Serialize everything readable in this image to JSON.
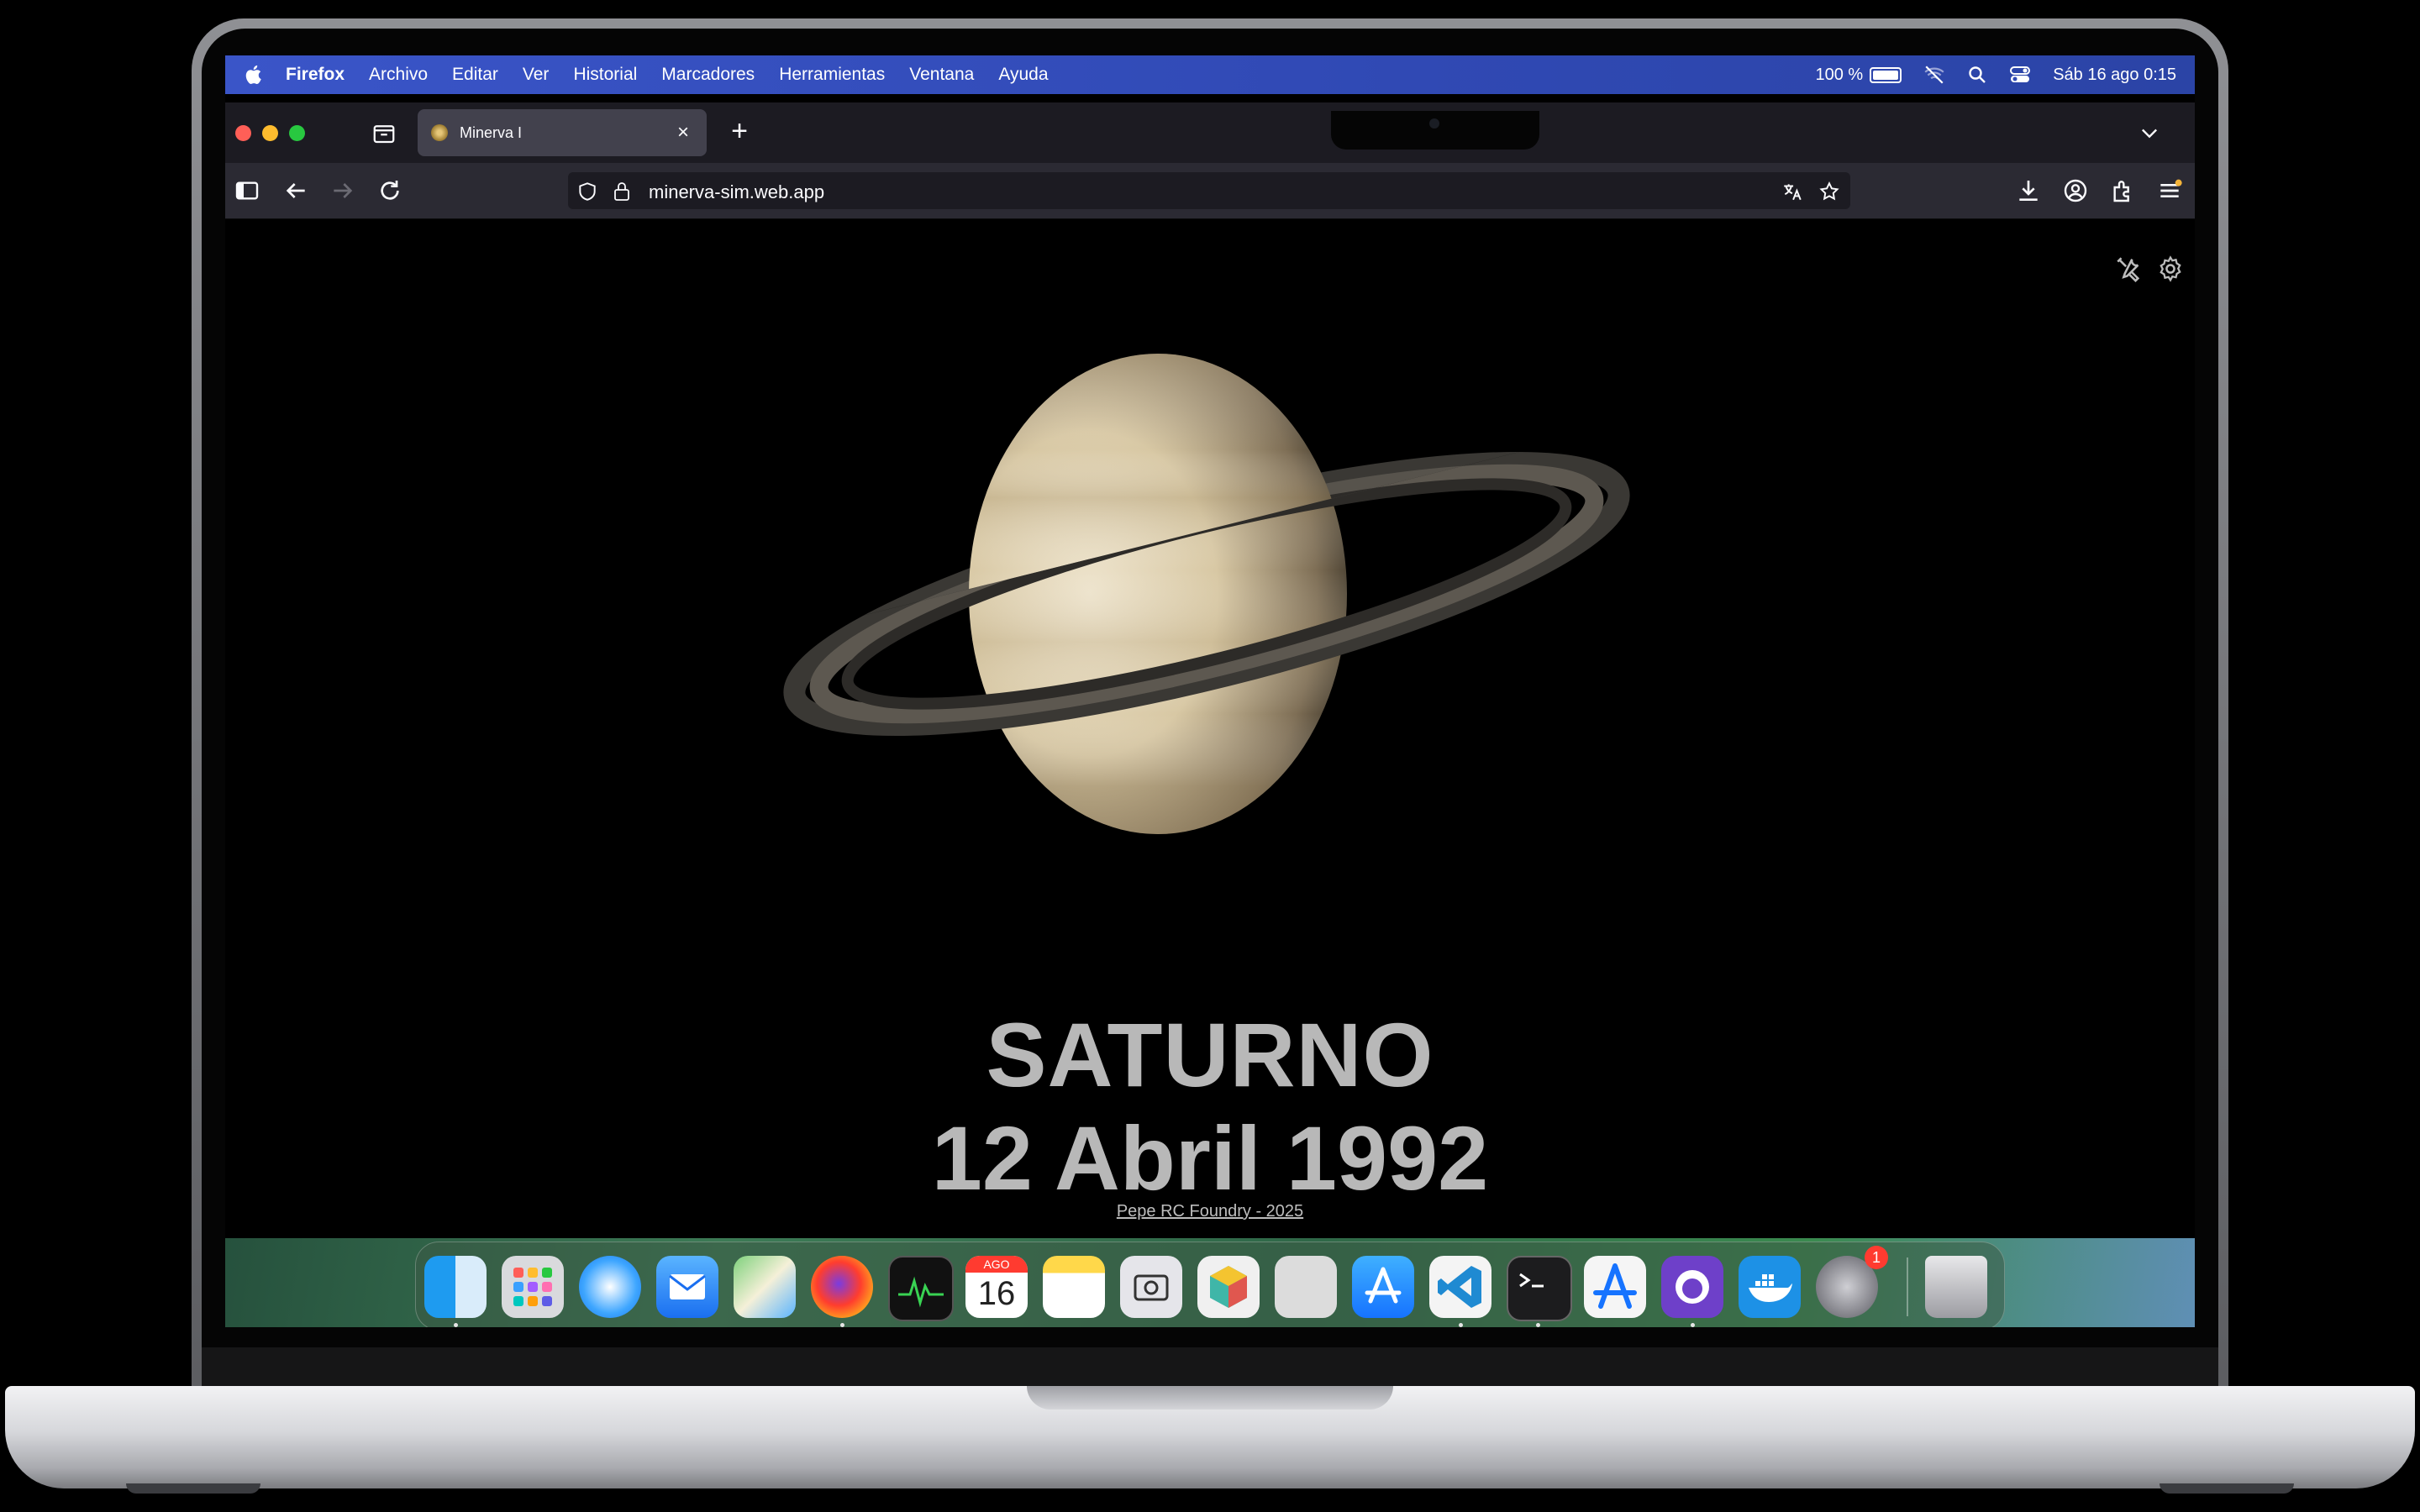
{
  "menubar": {
    "app_name": "Firefox",
    "menus": [
      "Archivo",
      "Editar",
      "Ver",
      "Historial",
      "Marcadores",
      "Herramientas",
      "Ventana",
      "Ayuda"
    ],
    "battery": "100 %",
    "datetime": "Sáb 16 ago 0:15"
  },
  "browser": {
    "tab_title": "Minerva I",
    "url": "minerva-sim.web.app"
  },
  "page": {
    "planet": "SATURNO",
    "date": "12 Abril 1992",
    "credit": "Pepe RC Foundry - 2025"
  },
  "dock": {
    "calendar_month": "AGO",
    "calendar_day": "16",
    "settings_badge": "1",
    "apps": [
      "finder-icon",
      "launchpad-icon",
      "safari-icon",
      "mail-icon",
      "maps-icon",
      "firefox-icon",
      "activity-monitor-icon",
      "calendar-icon",
      "notes-icon",
      "screenshot-icon",
      "cube-app-icon",
      "disk-utility-icon",
      "app-store-icon",
      "vscode-icon",
      "terminal-icon",
      "xcode-instruments-icon",
      "github-desktop-icon",
      "docker-icon",
      "system-settings-icon",
      "trash-icon"
    ]
  }
}
